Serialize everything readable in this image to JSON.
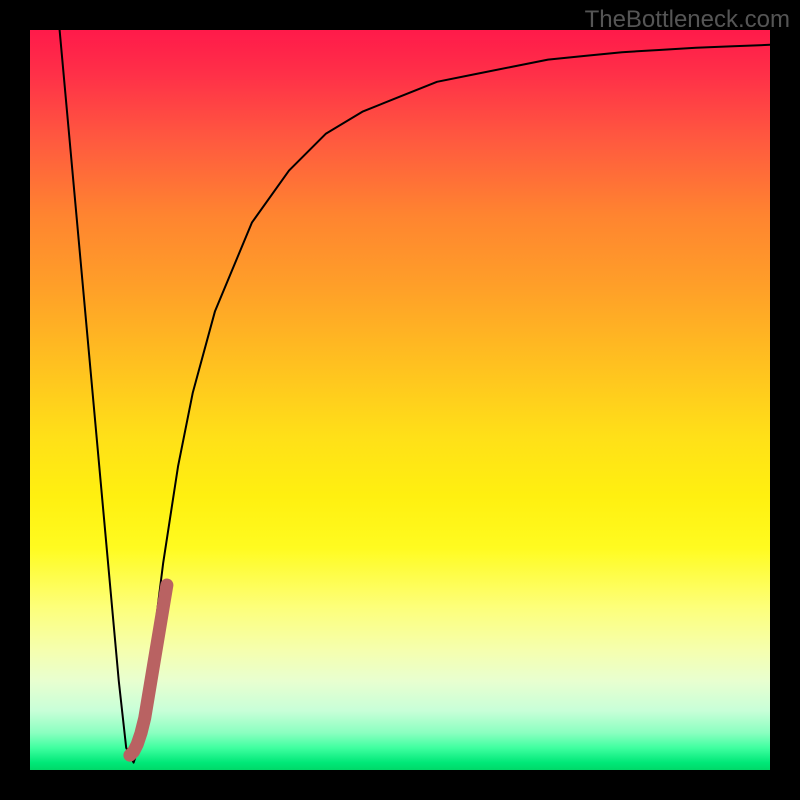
{
  "watermark": "TheBottleneck.com",
  "chart_data": {
    "type": "line",
    "title": "",
    "xlabel": "",
    "ylabel": "",
    "xlim": [
      0,
      100
    ],
    "ylim": [
      0,
      100
    ],
    "background_gradient": [
      "#ff1a4a",
      "#ffa028",
      "#fff010",
      "#00d868"
    ],
    "series": [
      {
        "name": "main-curve",
        "color": "#000000",
        "x": [
          4,
          6,
          8,
          10,
          12,
          13,
          14,
          15,
          16,
          18,
          20,
          22,
          25,
          30,
          35,
          40,
          45,
          50,
          55,
          60,
          65,
          70,
          75,
          80,
          85,
          90,
          95,
          100
        ],
        "values": [
          100,
          78,
          56,
          34,
          12,
          3,
          1,
          4,
          12,
          28,
          41,
          51,
          62,
          74,
          81,
          86,
          89,
          91,
          93,
          94,
          95,
          96,
          96.5,
          97,
          97.3,
          97.6,
          97.8,
          98
        ]
      },
      {
        "name": "highlight-segment",
        "color": "#ba6060",
        "x": [
          13.5,
          14,
          14.5,
          15,
          15.5,
          16,
          16.5,
          17,
          17.5,
          18,
          18.5
        ],
        "values": [
          2,
          2.5,
          3.5,
          5,
          7,
          10,
          13,
          16,
          19,
          22,
          25
        ]
      }
    ]
  }
}
